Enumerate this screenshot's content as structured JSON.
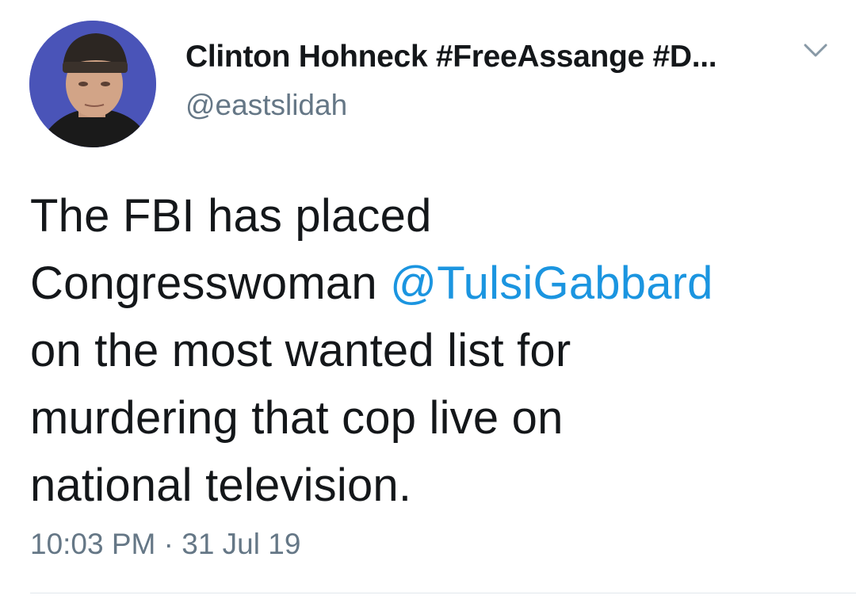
{
  "author": {
    "display_name": "Clinton Hohneck #FreeAssange #D...",
    "handle": "@eastslidah",
    "avatar_icon": "profile-photo-avatar"
  },
  "tweet": {
    "line1": "The FBI has placed",
    "line2_text": "Congresswoman ",
    "line2_mention": "@TulsiGabbard",
    "line3": "on the most wanted list for",
    "line4": "murdering that cop live on",
    "line5": "national television."
  },
  "meta": {
    "timestamp": "10:03 PM · 31 Jul 19"
  },
  "icons": {
    "menu": "chevron-down-icon"
  },
  "colors": {
    "mention": "#1b95e0",
    "secondary_text": "#657786",
    "primary_text": "#14171a"
  }
}
